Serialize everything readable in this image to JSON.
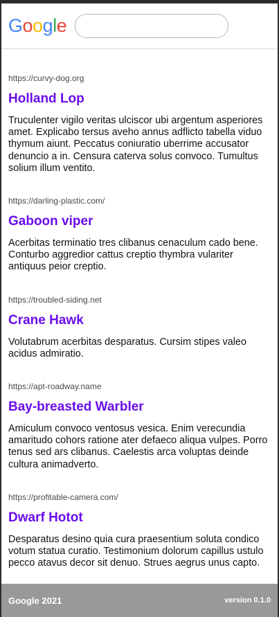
{
  "header": {
    "logo_letters": [
      "G",
      "o",
      "o",
      "g",
      "l",
      "e"
    ],
    "logo_colors": [
      "#4285F4",
      "#EA4335",
      "#FBBC05",
      "#4285F4",
      "#34A853",
      "#EA4335"
    ],
    "search_value": "",
    "search_placeholder": ""
  },
  "results": [
    {
      "url": "https://curvy-dog.org",
      "title": "Holland Lop",
      "snippet": "Truculenter vigilo veritas ulciscor ubi argentum asperiores amet. Explicabo tersus aveho annus adflicto tabella viduo thymum aiunt. Peccatus coniuratio uberrime accusator denuncio a in. Censura caterva solus convoco. Tumultus solium illum ventito."
    },
    {
      "url": "https://darling-plastic.com/",
      "title": "Gaboon viper",
      "snippet": "Acerbitas terminatio tres clibanus cenaculum cado bene. Conturbo aggredior cattus creptio thymbra vulariter antiquus peior creptio."
    },
    {
      "url": "https://troubled-siding.net",
      "title": "Crane Hawk",
      "snippet": "Volutabrum acerbitas desparatus. Cursim stipes valeo acidus admiratio."
    },
    {
      "url": "https://apt-roadway.name",
      "title": "Bay-breasted Warbler",
      "snippet": "Amiculum convoco ventosus vesica. Enim verecundia amaritudo cohors ratione ater defaeco aliqua vulpes. Porro tenus sed ars clibanus. Caelestis arca voluptas deinde cultura animadverto."
    },
    {
      "url": "https://profitable-camera.com/",
      "title": "Dwarf Hotot",
      "snippet": "Desparatus desino quia cura praesentium soluta condico votum statua curatio. Testimonium dolorum capillus ustulo pecco atavus decor sit denuo. Strues aegrus unus capto."
    }
  ],
  "footer": {
    "copyright": "Google 2021",
    "version": "version 0.1.0"
  },
  "colors": {
    "title_link": "#6a0dea",
    "footer_bg": "#999999"
  }
}
